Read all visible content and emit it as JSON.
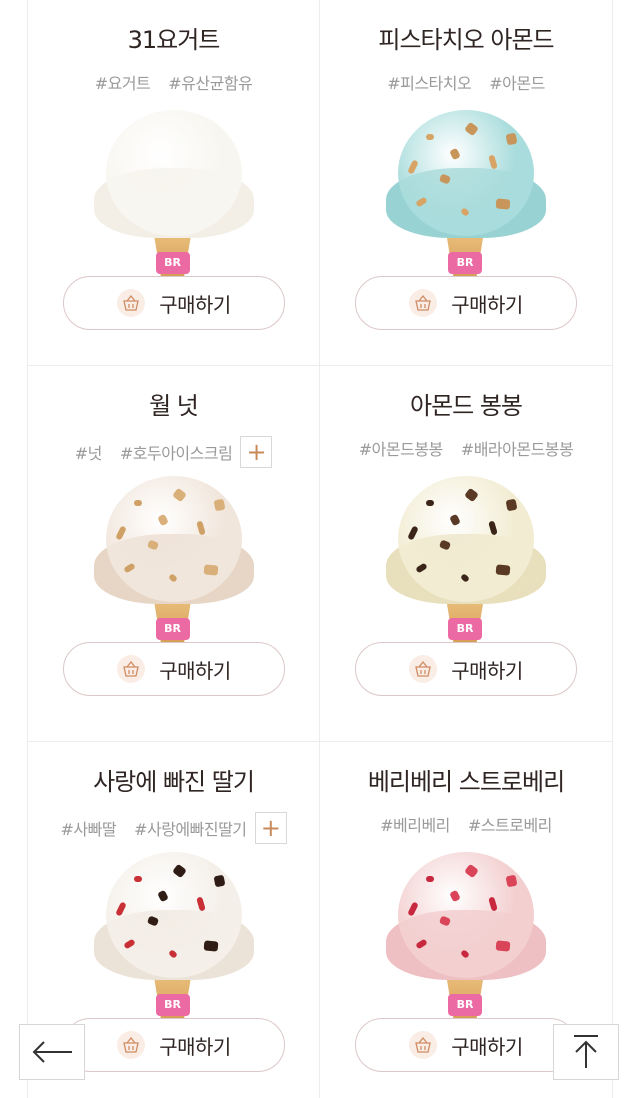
{
  "products": [
    {
      "name": "31요거트",
      "tags": [
        "#요거트",
        "#유산균함유"
      ],
      "has_more": false,
      "buy_label": "구매하기",
      "colors": {
        "scoop": "#f8f6f0",
        "base": "#f3efe6",
        "bits": []
      }
    },
    {
      "name": "피스타치오 아몬드",
      "tags": [
        "#피스타치오",
        "#아몬드"
      ],
      "has_more": false,
      "buy_label": "구매하기",
      "colors": {
        "scoop": "#a9dcdc",
        "base": "#98d2d2",
        "bits": [
          "#d7a466",
          "#c8955a"
        ]
      }
    },
    {
      "name": "월 넛",
      "tags": [
        "#넛",
        "#호두아이스크림"
      ],
      "has_more": true,
      "buy_label": "구매하기",
      "colors": {
        "scoop": "#f1e6dc",
        "base": "#e7d6c5",
        "bits": [
          "#cfa166",
          "#d9b07a"
        ]
      }
    },
    {
      "name": "아몬드 봉봉",
      "tags": [
        "#아몬드봉봉",
        "#배라아몬드봉봉"
      ],
      "has_more": false,
      "buy_label": "구매하기",
      "colors": {
        "scoop": "#f2ecd2",
        "base": "#e8dfbd",
        "bits": [
          "#3b2418",
          "#5a3a24"
        ]
      }
    },
    {
      "name": "사랑에 빠진 딸기",
      "tags": [
        "#사빠딸",
        "#사랑에빠진딸기"
      ],
      "has_more": true,
      "buy_label": "구매하기",
      "colors": {
        "scoop": "#f4efe8",
        "base": "#ebe2d8",
        "bits": [
          "#c93036",
          "#2f1c14"
        ]
      }
    },
    {
      "name": "베리베리 스트로베리",
      "tags": [
        "#베리베리",
        "#스트로베리"
      ],
      "has_more": false,
      "buy_label": "구매하기",
      "colors": {
        "scoop": "#f3cfcf",
        "base": "#eec0c4",
        "bits": [
          "#c8283e",
          "#d94458"
        ]
      }
    }
  ],
  "cone_logo": "BR",
  "nav": {
    "back_icon": "arrow-left-icon",
    "top_icon": "arrow-up-to-top-icon"
  }
}
